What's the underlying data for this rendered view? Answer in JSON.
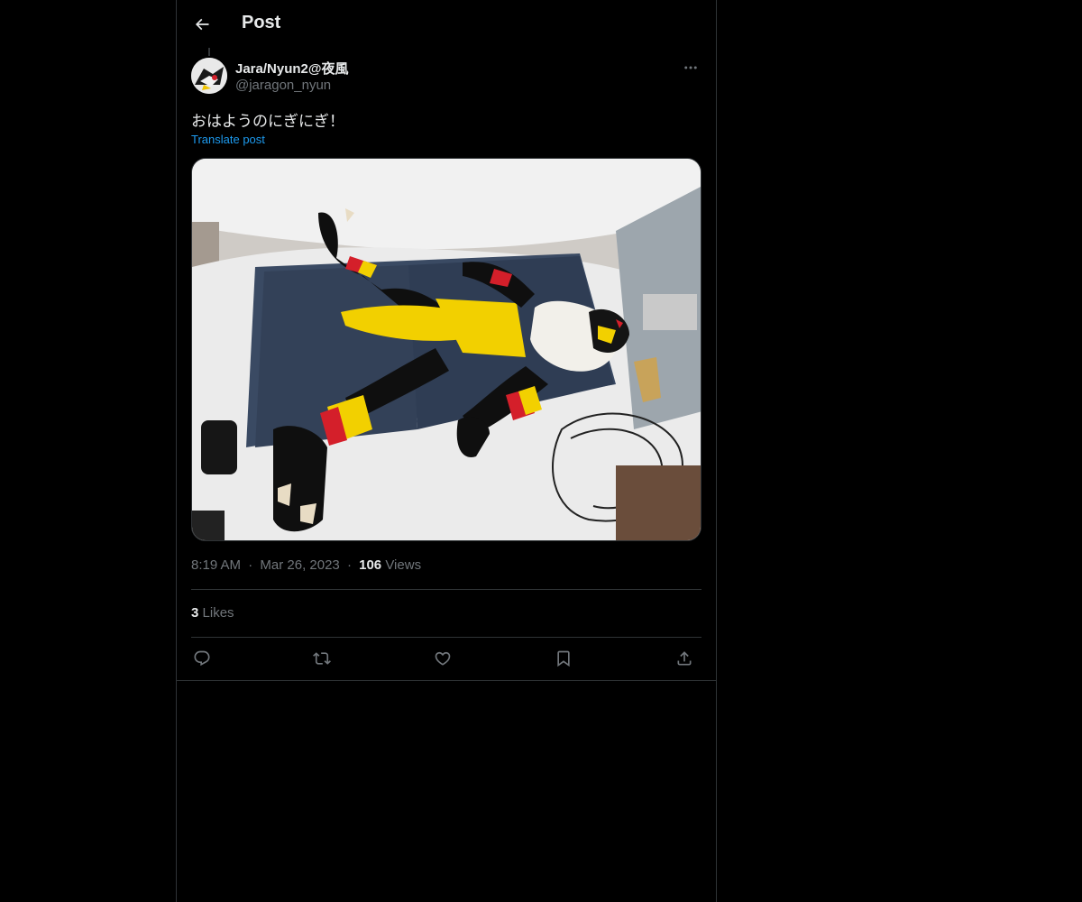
{
  "header": {
    "title": "Post",
    "back_icon": "arrow-left-icon"
  },
  "post": {
    "author": {
      "display_name": "Jara/Nyun2@夜風",
      "handle": "@jaragon_nyun",
      "more_icon": "more-horizontal-icon"
    },
    "text": "おはようのにぎにぎ！",
    "translate_label": "Translate post",
    "image_alt": "Black, yellow and red fursuit laid out on a blue mattress",
    "time": "8:19 AM",
    "dot": "·",
    "date": "Mar 26, 2023",
    "views_count": "106",
    "views_label": "Views",
    "likes_count": "3",
    "likes_label": "Likes"
  },
  "actions": [
    {
      "name": "reply",
      "icon": "reply-icon"
    },
    {
      "name": "repost",
      "icon": "repost-icon"
    },
    {
      "name": "like",
      "icon": "heart-icon"
    },
    {
      "name": "bookmark",
      "icon": "bookmark-icon"
    },
    {
      "name": "share",
      "icon": "share-icon"
    }
  ],
  "colors": {
    "background": "#000000",
    "border": "#2f3336",
    "text_primary": "#e7e9ea",
    "text_secondary": "#71767b",
    "link": "#1d9bf0"
  }
}
